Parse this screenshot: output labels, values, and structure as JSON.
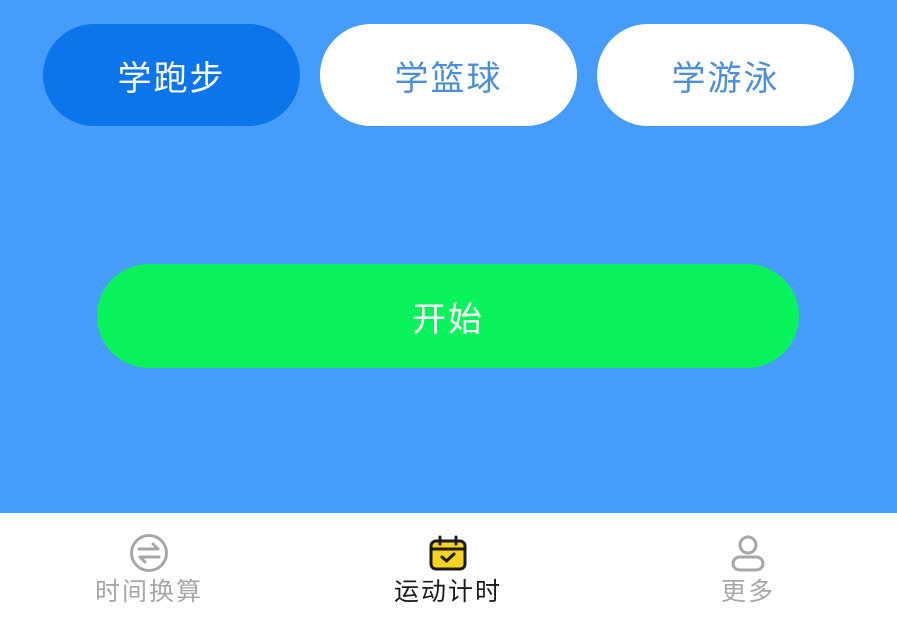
{
  "sport_tabs": [
    {
      "label": "学跑步",
      "selected": true
    },
    {
      "label": "学篮球",
      "selected": false
    },
    {
      "label": "学游泳",
      "selected": false
    }
  ],
  "start_button": {
    "label": "开始"
  },
  "bottom_nav": [
    {
      "label": "时间换算",
      "icon": "exchange-icon",
      "active": false
    },
    {
      "label": "运动计时",
      "icon": "calendar-check-icon",
      "active": true
    },
    {
      "label": "更多",
      "icon": "user-icon",
      "active": false
    }
  ],
  "colors": {
    "background": "#469cfa",
    "active_tab": "#0c75ec",
    "inactive_tab_text": "#4c8fd6",
    "start_button": "#08f35b",
    "nav_active_icon": "#f7d21e",
    "nav_inactive": "#a7a7a7"
  }
}
